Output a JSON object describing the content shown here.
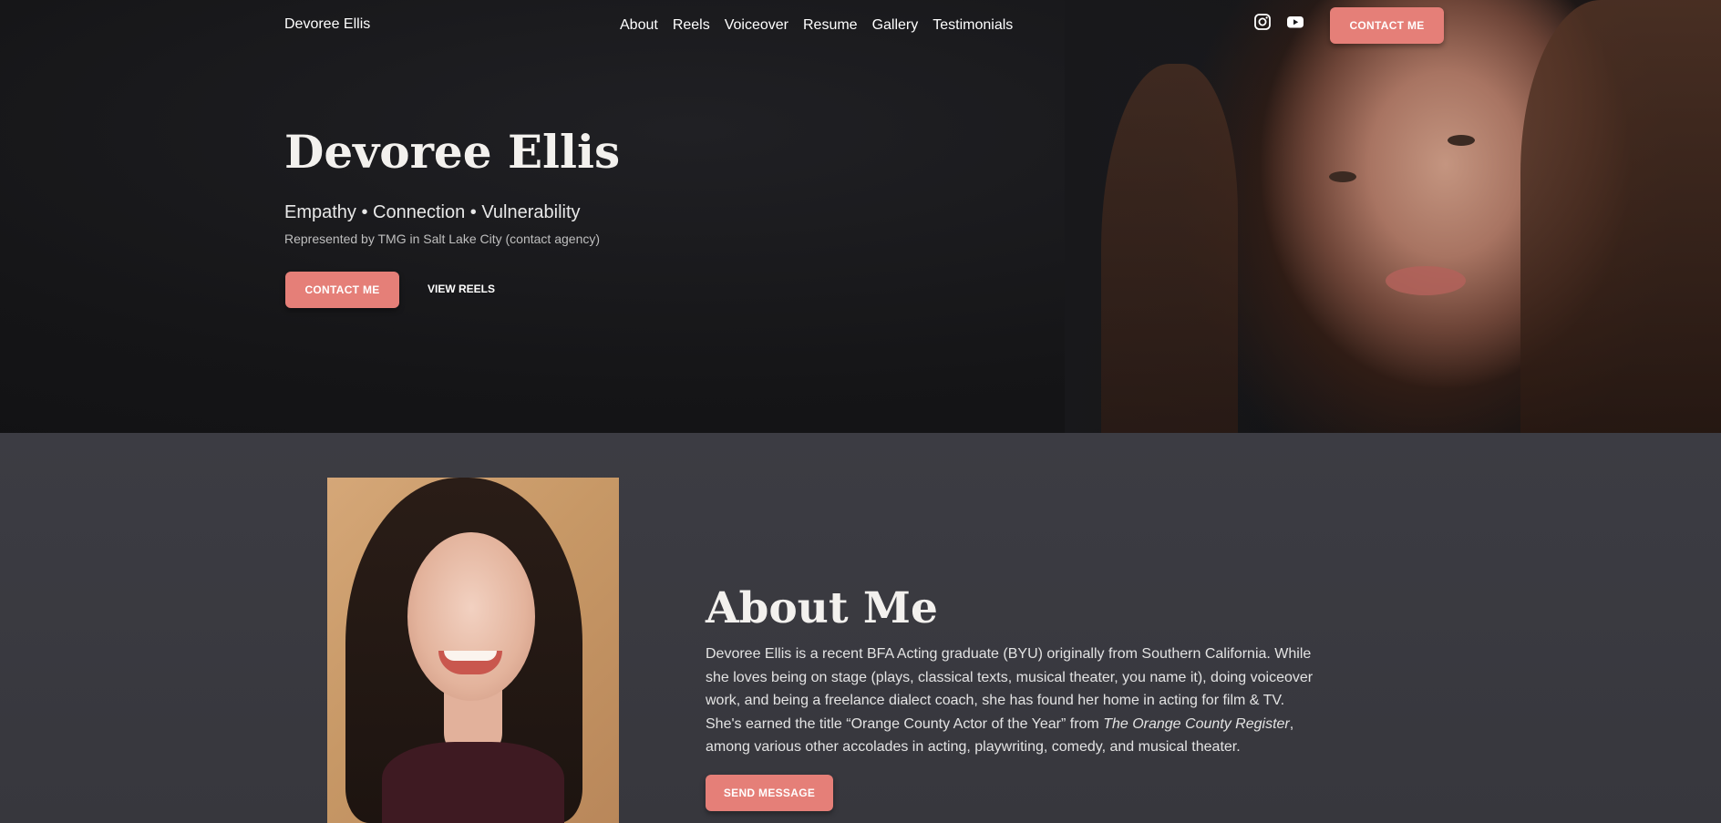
{
  "nav": {
    "brand": "Devoree Ellis",
    "links": [
      "About",
      "Reels",
      "Voiceover",
      "Resume",
      "Gallery",
      "Testimonials"
    ],
    "social": [
      "instagram-icon",
      "youtube-icon"
    ],
    "contact_label": "CONTACT ME"
  },
  "hero": {
    "title": "Devoree Ellis",
    "tagline": "Empathy • Connection • Vulnerability",
    "subtitle": "Represented by TMG in Salt Lake City (contact agency)",
    "contact_label": "CONTACT ME",
    "reels_label": "VIEW REELS"
  },
  "about": {
    "title": "About Me",
    "text_part1": "Devoree Ellis is a recent BFA Acting graduate (BYU) originally from Southern California. While she loves being on stage (plays, classical texts, musical theater, you name it), doing voiceover work, and being a freelance dialect coach, she has found her home in acting for film & TV. She's earned the title “Orange County Actor of the Year” from ",
    "text_italic": "The Orange County Register",
    "text_part2": ", among various other accolades in acting, playwriting, comedy, and musical theater.",
    "send_label": "SEND MESSAGE"
  },
  "colors": {
    "accent": "#e57f78",
    "hero_bg": "#18181b",
    "about_bg": "#3c3c43"
  }
}
